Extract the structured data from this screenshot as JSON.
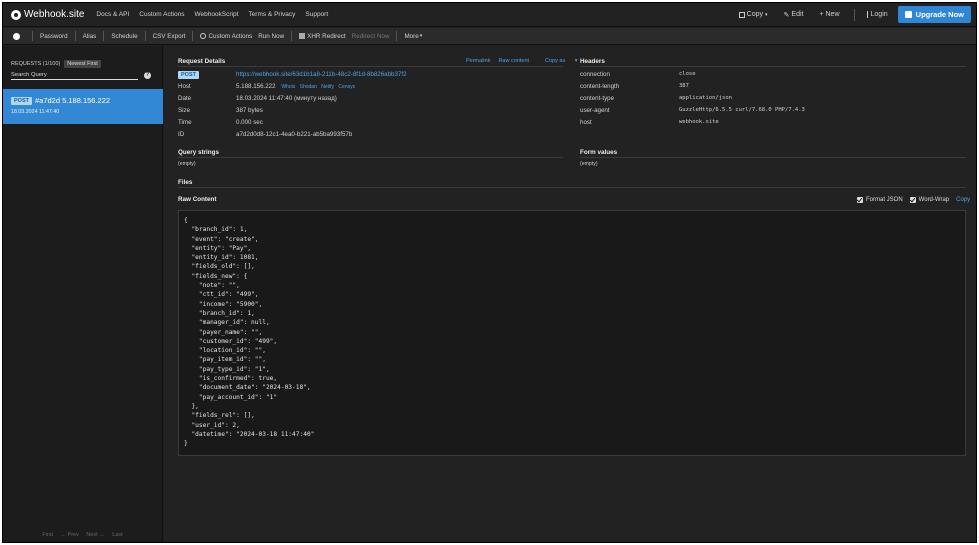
{
  "topbar": {
    "brand": "Webhook.site",
    "nav": [
      "Docs & API",
      "Custom Actions",
      "WebhookScript",
      "Terms & Privacy",
      "Support"
    ],
    "copy_label": "Copy",
    "edit_label": "Edit",
    "new_label": "+ New",
    "login_label": "Login",
    "upgrade_label": "Upgrade Now"
  },
  "toolbar": {
    "items": [
      "Password",
      "Alias",
      "Schedule",
      "CSV Export",
      "Custom Actions",
      "Run Now",
      "XHR Redirect",
      "Redirect Now",
      "More"
    ]
  },
  "sidebar": {
    "requests_label": "REQUESTS (1/100)",
    "sort_label": "Newest First",
    "search_placeholder": "Search Query",
    "request": {
      "method": "POST",
      "title": "#a7d2d 5.188.156.222",
      "time": "18.03.2024 11:47:40"
    },
    "pager": [
      "First",
      "← Prev",
      "Next →",
      "Last"
    ]
  },
  "request_details": {
    "title": "Request Details",
    "links": [
      "Permalink",
      "Raw content",
      "Copy as"
    ],
    "method": "POST",
    "url": "https://webhook.site/63d1b1a8-211b-48c2-8f1d-8b826abb37f2",
    "rows": [
      {
        "label": "Host",
        "value": "5.188.156.222"
      },
      {
        "label": "Date",
        "value": "18.03.2024 11:47:40 (минуту назад)"
      },
      {
        "label": "Size",
        "value": "387 bytes"
      },
      {
        "label": "Time",
        "value": "0.000 sec"
      },
      {
        "label": "ID",
        "value": "a7d2d0d8-12c1-4ea0-b221-ab5ba993f57b"
      }
    ],
    "host_links": [
      "Whois",
      "Shodan",
      "Netify",
      "Censys"
    ]
  },
  "headers": {
    "title": "Headers",
    "rows": [
      {
        "key": "connection",
        "value": "close"
      },
      {
        "key": "content-length",
        "value": "387"
      },
      {
        "key": "content-type",
        "value": "application/json"
      },
      {
        "key": "user-agent",
        "value": "GuzzleHttp/6.5.5 curl/7.68.0 PHP/7.4.3"
      },
      {
        "key": "host",
        "value": "webhook.site"
      }
    ]
  },
  "query_strings": {
    "title": "Query strings",
    "value": "(empty)"
  },
  "form_values": {
    "title": "Form values",
    "value": "(empty)"
  },
  "files": {
    "title": "Files"
  },
  "raw_content": {
    "title": "Raw Content",
    "format_json_label": "Format JSON",
    "word_wrap_label": "Word-Wrap",
    "copy_label": "Copy",
    "body": "{\n  \"branch_id\": 1,\n  \"event\": \"create\",\n  \"entity\": \"Pay\",\n  \"entity_id\": 1081,\n  \"fields_old\": [],\n  \"fields_new\": {\n    \"note\": \"\",\n    \"ctt_id\": \"499\",\n    \"income\": \"5900\",\n    \"branch_id\": 1,\n    \"manager_id\": null,\n    \"payer_name\": \"\",\n    \"customer_id\": \"499\",\n    \"location_id\": \"\",\n    \"pay_item_id\": \"\",\n    \"pay_type_id\": \"1\",\n    \"is_confirmed\": true,\n    \"document_date\": \"2024-03-18\",\n    \"pay_account_id\": \"1\"\n  },\n  \"fields_rel\": [],\n  \"user_id\": 2,\n  \"datetime\": \"2024-03-18 11:47:40\"\n}"
  }
}
